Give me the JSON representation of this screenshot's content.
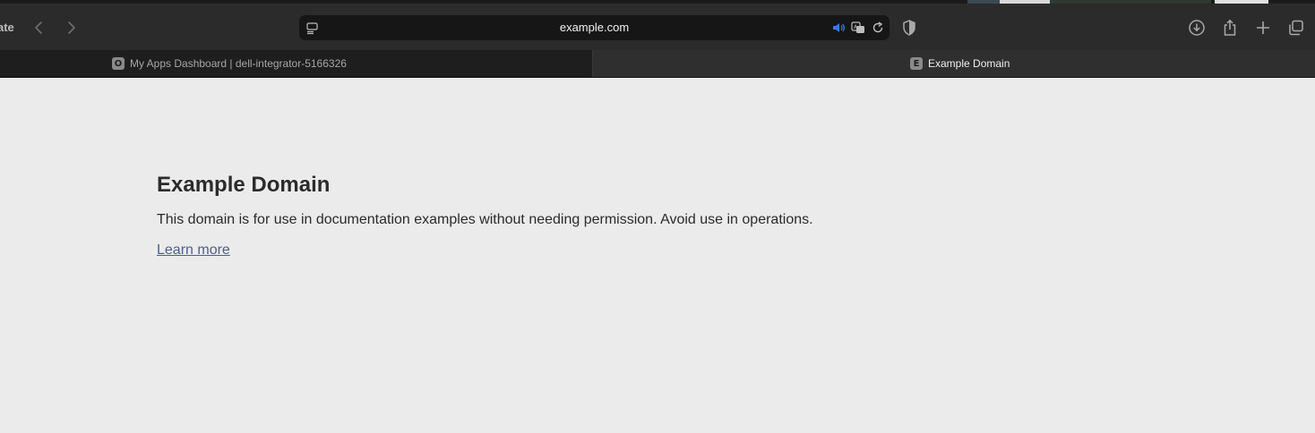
{
  "window": {
    "title_fragment": "ate"
  },
  "address_bar": {
    "url": "example.com"
  },
  "tabs": [
    {
      "label": "My Apps Dashboard | dell-integrator-5166326",
      "favicon_letter": "O",
      "active": false
    },
    {
      "label": "Example Domain",
      "favicon_letter": "E",
      "active": true
    }
  ],
  "page": {
    "heading": "Example Domain",
    "paragraph": "This domain is for use in documentation examples without needing permission. Avoid use in operations.",
    "link_text": "Learn more"
  },
  "colors": {
    "accent_audio": "#2f7bf5",
    "link": "#4d5f91",
    "page_background": "#ebebeb",
    "toolbar_background": "#2b2b2b"
  },
  "icons": {
    "page_menu": "page-menu-icon",
    "audio": "speaker-icon",
    "translate": "translate-icon",
    "reload": "reload-icon",
    "privacy": "shield-icon",
    "downloads": "download-icon",
    "share": "share-icon",
    "new_tab": "plus-icon",
    "tab_overview": "tab-overview-icon"
  }
}
